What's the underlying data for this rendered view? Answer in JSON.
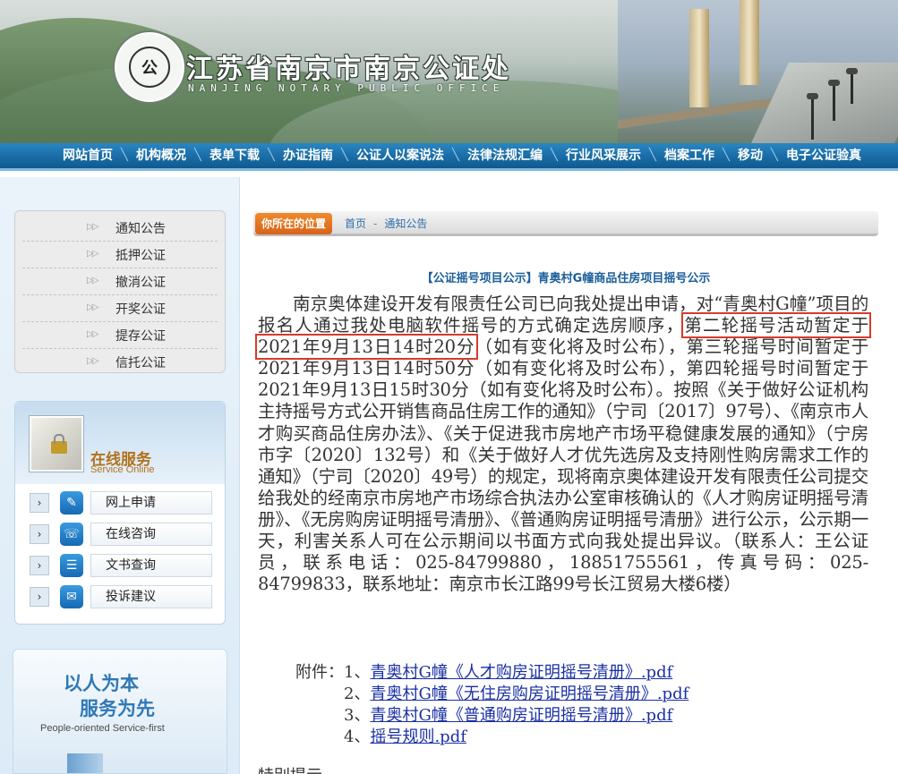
{
  "header": {
    "title": "江苏省南京市南京公证处",
    "subtitle": "NANJING NOTARY PUBLIC OFFICE",
    "seal_text": "NANJING NOTARY PUBLIC OFFICE",
    "seal_glyph": "公"
  },
  "nav": {
    "items": [
      "网站首页",
      "机构概况",
      "表单下载",
      "办证指南",
      "公证人以案说法",
      "法律法规汇编",
      "行业风采展示",
      "档案工作",
      "移动",
      "电子公证验真"
    ]
  },
  "sidebar": {
    "notices": [
      "通知公告",
      "抵押公证",
      "撤消公证",
      "开奖公证",
      "提存公证",
      "信托公证"
    ],
    "notice_arrow": "▷▷",
    "service": {
      "title": "在线服务",
      "subtitle": "Service Online",
      "items": [
        {
          "label": "网上申请",
          "icon": "edit-icon",
          "glyph": "✎"
        },
        {
          "label": "在线咨询",
          "icon": "headset-icon",
          "glyph": "☏"
        },
        {
          "label": "文书查询",
          "icon": "list-icon",
          "glyph": "☰"
        },
        {
          "label": "投诉建议",
          "icon": "chat-icon",
          "glyph": "✉"
        }
      ],
      "chevron": "›"
    },
    "slogan": {
      "line1": "以人为本",
      "line2": "服务为先",
      "english": "People-oriented  Service-first"
    }
  },
  "breadcrumb": {
    "tag": "你所在的位置",
    "home": "首页",
    "separator": "-",
    "current": "通知公告"
  },
  "article": {
    "title": "【公证摇号项目公示】青奥村G幢商品住房项目摇号公示",
    "body_before": "南京奥体建设开发有限责任公司已向我处提出申请，对“青奥村G幢”项目的报名人通过我处电脑软件摇号的方式确定选房顺序，",
    "body_highlight": "第二轮摇号活动暂定于2021年9月13日14时20分",
    "body_after": "（如有变化将及时公布），第三轮摇号时间暂定于2021年9月13日14时50分（如有变化将及时公布），第四轮摇号时间暂定于2021年9月13日15时30分（如有变化将及时公布）。按照《关于做好公证机构主持摇号方式公开销售商品住房工作的通知》（宁司〔2017〕97号）、《南京市人才购买商品住房办法》、《关于促进我市房地产市场平稳健康发展的通知》（宁房市字〔2020〕132号）和《关于做好人才优先选房及支持刚性购房需求工作的通知》（宁司〔2020〕49号）的规定，现将南京奥体建设开发有限责任公司提交给我处的经南京市房地产市场综合执法办公室审核确认的《人才购房证明摇号清册》、《无房购房证明摇号清册》、《普通购房证明摇号清册》进行公示，公示期一天，利害关系人可在公示期间以书面方式向我处提出异议。（联系人：王公证员，联系电话：025-84799880，18851755561，传真号码：025-84799833，联系地址：南京市长江路99号长江贸易大楼6楼）",
    "attachments_label": "附件：",
    "attachments": [
      {
        "index": "1、",
        "text": "青奥村G幢《人才购房证明摇号清册》.pdf"
      },
      {
        "index": "2、",
        "text": "青奥村G幢《无住房购房证明摇号清册》.pdf"
      },
      {
        "index": "3、",
        "text": "青奥村G幢《普通购房证明摇号清册》.pdf"
      },
      {
        "index": "4、",
        "text": "摇号规则.pdf"
      }
    ],
    "next_heading": "特别提示"
  },
  "colors": {
    "nav": "#1b6ea8",
    "breadcrumb_tag": "#e8752a",
    "title": "#1c5f9b",
    "highlight_box": "#d63b2c",
    "link": "#1a2fa3"
  }
}
